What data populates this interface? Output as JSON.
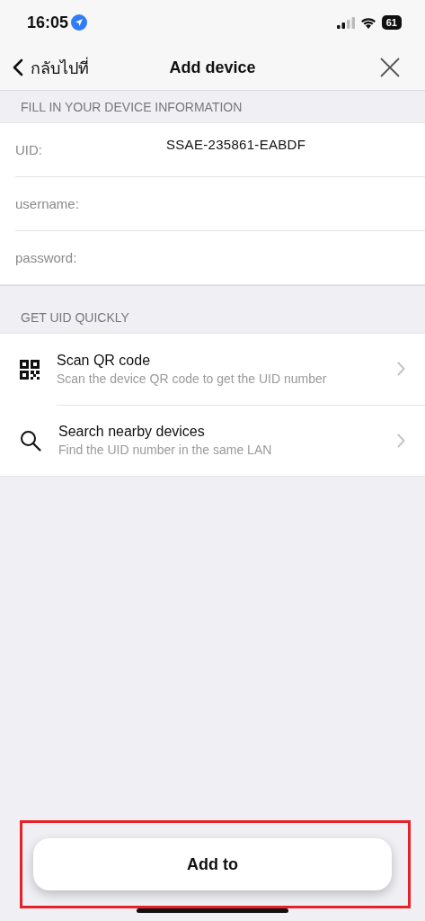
{
  "status_bar": {
    "time": "16:05",
    "battery": "61"
  },
  "nav": {
    "back_label": "กลับไปที่",
    "title": "Add device"
  },
  "device_info": {
    "header": "FILL IN YOUR DEVICE INFORMATION",
    "fields": [
      {
        "label": "UID:",
        "value": "SSAE-235861-EABDF"
      },
      {
        "label": "username:"
      },
      {
        "label": "password:"
      }
    ]
  },
  "quick_uid": {
    "header": "GET UID QUICKLY",
    "items": [
      {
        "kind": "qr",
        "title": "Scan QR code",
        "subtitle": "Scan the device QR code to get the UID number"
      },
      {
        "kind": "search",
        "title": "Search nearby devices",
        "subtitle": "Find the UID number in the same LAN"
      }
    ]
  },
  "add_button": {
    "label": "Add to",
    "highlighted": true
  }
}
